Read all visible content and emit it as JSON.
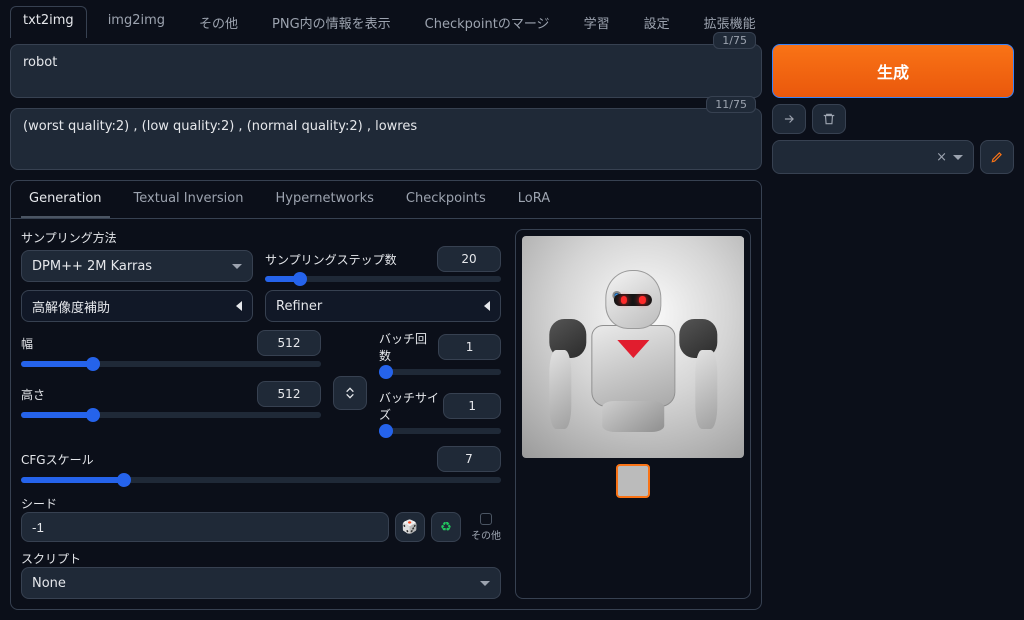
{
  "top_tabs": {
    "items": [
      "txt2img",
      "img2img",
      "その他",
      "PNG内の情報を表示",
      "Checkpointのマージ",
      "学習",
      "設定",
      "拡張機能"
    ],
    "active": 0
  },
  "prompt": {
    "value": "robot",
    "counter": "1/75"
  },
  "neg_prompt": {
    "value": "(worst quality:2) , (low quality:2) , (normal quality:2) , lowres",
    "counter": "11/75"
  },
  "right": {
    "generate": "生成",
    "styles_clear": "×"
  },
  "sub_tabs": {
    "items": [
      "Generation",
      "Textual Inversion",
      "Hypernetworks",
      "Checkpoints",
      "LoRA"
    ],
    "active": 0
  },
  "controls": {
    "sampler_label": "サンプリング方法",
    "sampler_value": "DPM++ 2M Karras",
    "steps_label": "サンプリングステップ数",
    "steps_value": "20",
    "hires_label": "高解像度補助",
    "refiner_label": "Refiner",
    "width_label": "幅",
    "width_value": "512",
    "height_label": "高さ",
    "height_value": "512",
    "batch_count_label": "バッチ回数",
    "batch_count_value": "1",
    "batch_size_label": "バッチサイズ",
    "batch_size_value": "1",
    "cfg_label": "CFGスケール",
    "cfg_value": "7",
    "seed_label": "シード",
    "seed_value": "-1",
    "extra_label": "その他",
    "script_label": "スクリプト",
    "script_value": "None",
    "dice": "🎲",
    "recycle": "♻"
  }
}
